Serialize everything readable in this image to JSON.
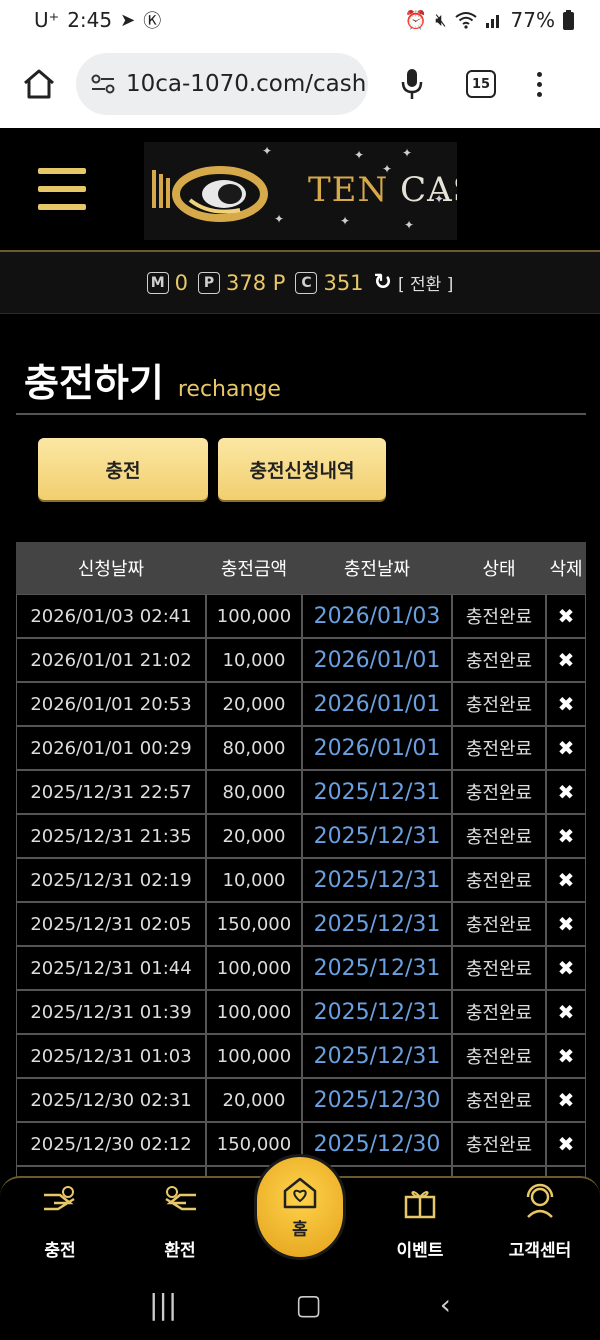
{
  "status_bar": {
    "carrier": "U⁺",
    "time": "2:45",
    "battery": "77%"
  },
  "browser": {
    "url": "10ca-1070.com/cash",
    "tab_count": "15"
  },
  "site": {
    "logo_text_ten": "TEN",
    "logo_text_casino": "CASINO",
    "points": {
      "m_label": "M",
      "m_value": "0",
      "p_label": "P",
      "p_value": "378 P",
      "c_label": "C",
      "c_value": "351",
      "convert": "[ 전환 ]"
    }
  },
  "page": {
    "title": "충전하기",
    "subtitle": "rechange",
    "buttons": {
      "charge": "충전",
      "history": "충전신청내역"
    }
  },
  "table": {
    "headers": [
      "신청날짜",
      "충전금액",
      "충전날짜",
      "상태",
      "삭제"
    ],
    "rows": [
      [
        "2026/01/03 02:41",
        "100,000",
        "2026/01/03",
        "충전완료",
        "✖"
      ],
      [
        "2026/01/01 21:02",
        "10,000",
        "2026/01/01",
        "충전완료",
        "✖"
      ],
      [
        "2026/01/01 20:53",
        "20,000",
        "2026/01/01",
        "충전완료",
        "✖"
      ],
      [
        "2026/01/01 00:29",
        "80,000",
        "2026/01/01",
        "충전완료",
        "✖"
      ],
      [
        "2025/12/31 22:57",
        "80,000",
        "2025/12/31",
        "충전완료",
        "✖"
      ],
      [
        "2025/12/31 21:35",
        "20,000",
        "2025/12/31",
        "충전완료",
        "✖"
      ],
      [
        "2025/12/31 02:19",
        "10,000",
        "2025/12/31",
        "충전완료",
        "✖"
      ],
      [
        "2025/12/31 02:05",
        "150,000",
        "2025/12/31",
        "충전완료",
        "✖"
      ],
      [
        "2025/12/31 01:44",
        "100,000",
        "2025/12/31",
        "충전완료",
        "✖"
      ],
      [
        "2025/12/31 01:39",
        "100,000",
        "2025/12/31",
        "충전완료",
        "✖"
      ],
      [
        "2025/12/31 01:03",
        "100,000",
        "2025/12/31",
        "충전완료",
        "✖"
      ],
      [
        "2025/12/30 02:31",
        "20,000",
        "2025/12/30",
        "충전완료",
        "✖"
      ],
      [
        "2025/12/30 02:12",
        "150,000",
        "2025/12/30",
        "충전완료",
        "✖"
      ],
      [
        "",
        "",
        "",
        "",
        ""
      ]
    ]
  },
  "bottom_nav": {
    "charge": "충전",
    "exchange": "환전",
    "home": "홈",
    "event": "이벤트",
    "support": "고객센터"
  },
  "colors": {
    "gold": "#e8c768",
    "link_blue": "#6aa0e0",
    "header_bg": "#444444"
  }
}
